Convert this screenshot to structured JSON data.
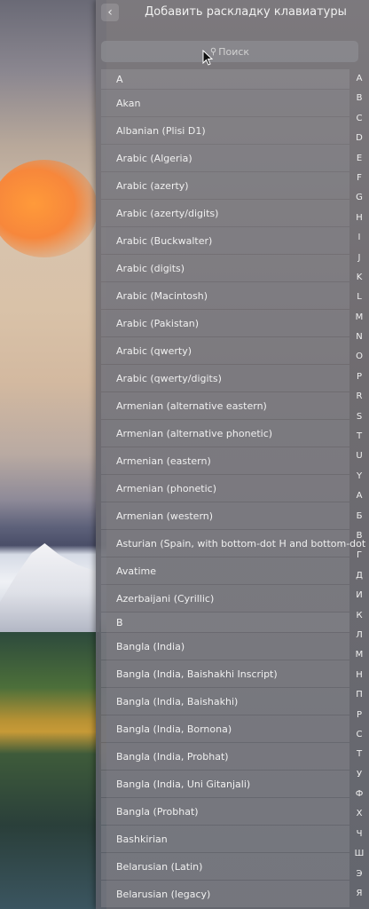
{
  "header": {
    "back_icon": "‹",
    "title": "Добавить раскладку клавиатуры"
  },
  "search": {
    "icon": "⚲",
    "placeholder": "Поиск"
  },
  "list": [
    {
      "label": "A",
      "type": "section"
    },
    {
      "label": "Akan"
    },
    {
      "label": "Albanian (Plisi D1)"
    },
    {
      "label": "Arabic (Algeria)"
    },
    {
      "label": "Arabic (azerty)"
    },
    {
      "label": "Arabic (azerty/digits)"
    },
    {
      "label": "Arabic (Buckwalter)"
    },
    {
      "label": "Arabic (digits)"
    },
    {
      "label": "Arabic (Macintosh)"
    },
    {
      "label": "Arabic (Pakistan)"
    },
    {
      "label": "Arabic (qwerty)"
    },
    {
      "label": "Arabic (qwerty/digits)"
    },
    {
      "label": "Armenian (alternative eastern)"
    },
    {
      "label": "Armenian (alternative phonetic)"
    },
    {
      "label": "Armenian (eastern)"
    },
    {
      "label": "Armenian (phonetic)"
    },
    {
      "label": "Armenian (western)"
    },
    {
      "label": "Asturian (Spain, with bottom-dot H and bottom-dot L)"
    },
    {
      "label": "Avatime"
    },
    {
      "label": "Azerbaijani (Cyrillic)"
    },
    {
      "label": "B",
      "type": "section"
    },
    {
      "label": "Bangla (India)"
    },
    {
      "label": "Bangla (India, Baishakhi Inscript)"
    },
    {
      "label": "Bangla (India, Baishakhi)"
    },
    {
      "label": "Bangla (India, Bornona)"
    },
    {
      "label": "Bangla (India, Probhat)"
    },
    {
      "label": "Bangla (India, Uni Gitanjali)"
    },
    {
      "label": "Bangla (Probhat)"
    },
    {
      "label": "Bashkirian"
    },
    {
      "label": "Belarusian (Latin)"
    },
    {
      "label": "Belarusian (legacy)"
    }
  ],
  "alphabet": [
    "A",
    "B",
    "C",
    "D",
    "E",
    "F",
    "G",
    "H",
    "I",
    "J",
    "K",
    "L",
    "M",
    "N",
    "O",
    "P",
    "R",
    "S",
    "T",
    "U",
    "Y",
    "А",
    "Б",
    "В",
    "Г",
    "Д",
    "И",
    "К",
    "Л",
    "М",
    "Н",
    "П",
    "Р",
    "С",
    "Т",
    "У",
    "Ф",
    "Х",
    "Ч",
    "Ш",
    "Э",
    "Я"
  ],
  "colors": {
    "panel": "#6b6a70",
    "text": "#f0f0f0",
    "accent_orange": "#f7873b"
  }
}
